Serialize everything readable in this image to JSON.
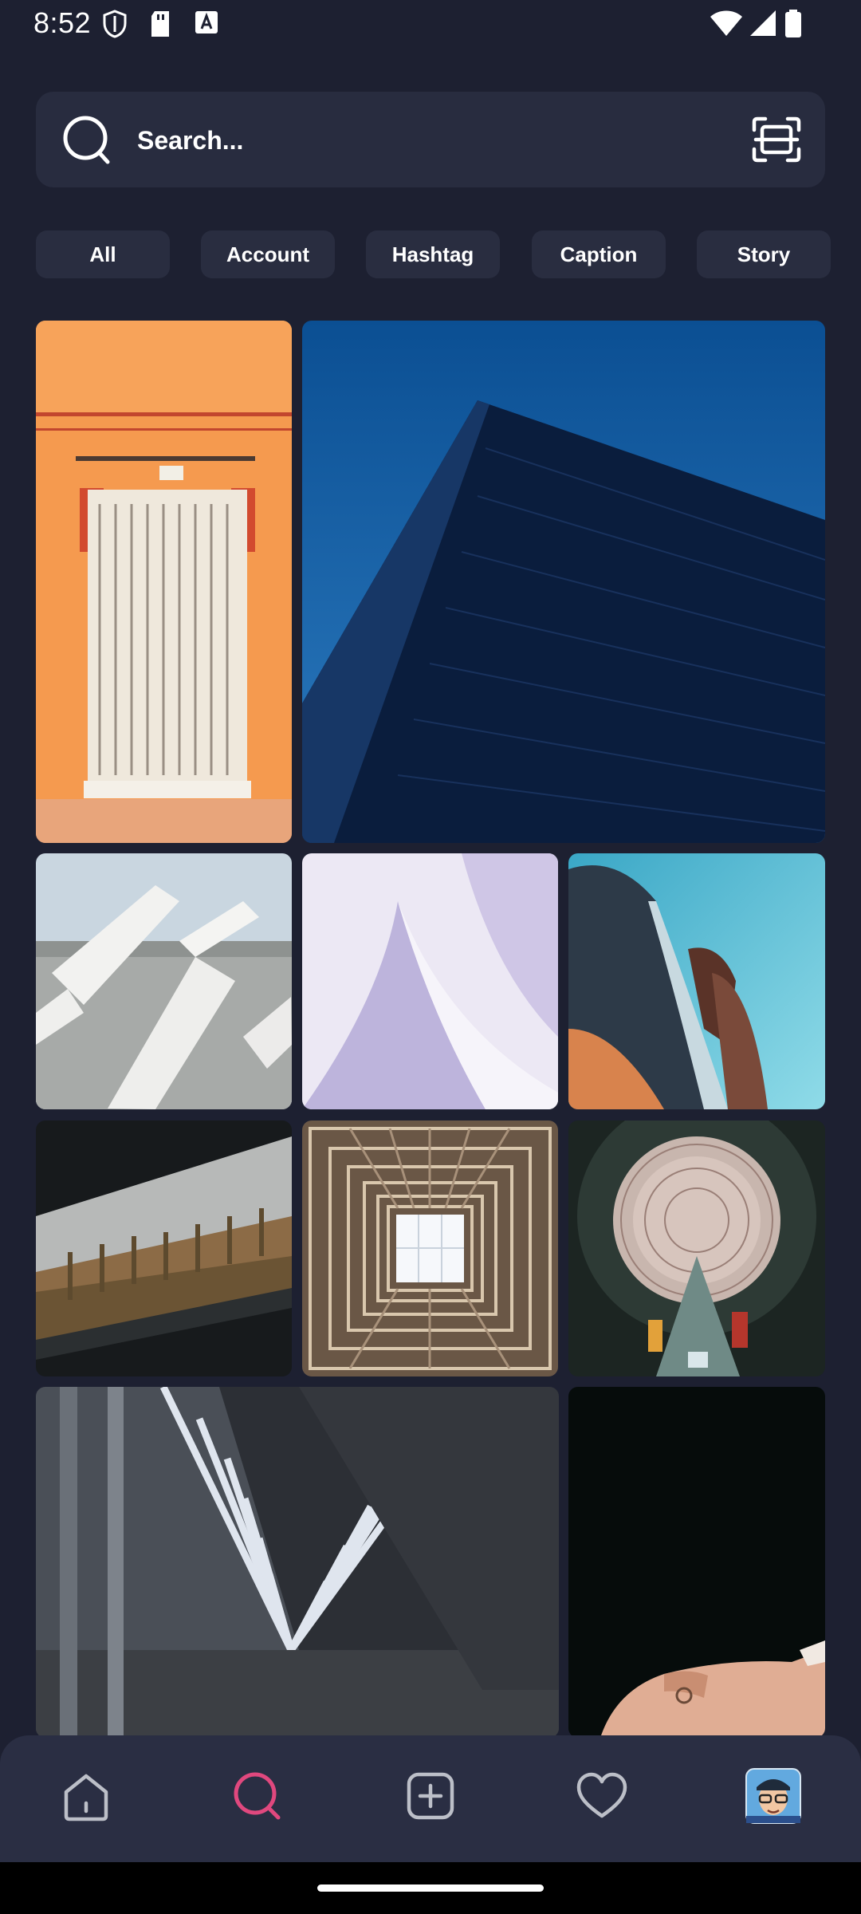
{
  "status_bar": {
    "time": "8:52",
    "left_icons": [
      "shield-icon",
      "sd-card-icon",
      "font-icon"
    ],
    "right_icons": [
      "wifi-icon",
      "signal-icon",
      "battery-icon"
    ]
  },
  "search": {
    "placeholder": "Search...",
    "left_icon": "search-icon",
    "right_icon": "scan-icon"
  },
  "filters": [
    {
      "label": "All"
    },
    {
      "label": "Account"
    },
    {
      "label": "Hashtag"
    },
    {
      "label": "Caption"
    },
    {
      "label": "Story"
    }
  ],
  "grid_tiles": [
    {
      "subject": "orange-door"
    },
    {
      "subject": "blue-building"
    },
    {
      "subject": "white-beams"
    },
    {
      "subject": "lavender-curve"
    },
    {
      "subject": "teal-sky-architecture"
    },
    {
      "subject": "forest-window"
    },
    {
      "subject": "skylight-grid"
    },
    {
      "subject": "atrium-looking-up"
    },
    {
      "subject": "arch-corridor"
    },
    {
      "subject": "hand-dark"
    }
  ],
  "bottom_nav": {
    "items": [
      "home-icon",
      "search-icon",
      "add-icon",
      "heart-icon",
      "avatar"
    ],
    "active": "search-icon",
    "active_color": "#e0487e"
  },
  "colors": {
    "background": "#1d2031",
    "surface": "#282c3f",
    "chip": "#292d40",
    "accent": "#e0487e"
  }
}
